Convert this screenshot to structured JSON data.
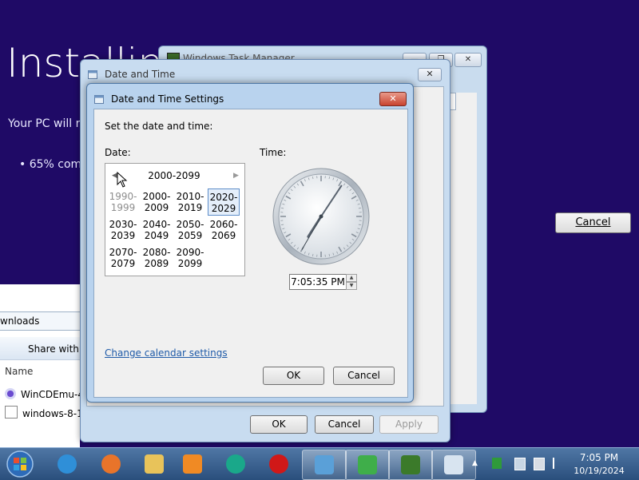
{
  "installer": {
    "title": "Installing",
    "subtitle": "Your PC will re",
    "progress_text": "65% com",
    "cancel_label": "Cancel"
  },
  "task_manager": {
    "title": "Windows Task Manager",
    "tab_fragment": "s"
  },
  "explorer": {
    "address": "wnloads",
    "share_label": "Share with",
    "column_name": "Name",
    "rows": [
      {
        "name": "WinCDEmu-4"
      },
      {
        "name": "windows-8-1-"
      }
    ]
  },
  "date_time_dialog": {
    "title": "Date and Time",
    "close_label": "✕",
    "ok_label": "OK",
    "cancel_label": "Cancel",
    "apply_label": "Apply"
  },
  "settings_dialog": {
    "title": "Date and Time Settings",
    "close_label": "✕",
    "instruction": "Set the date and time:",
    "date_label": "Date:",
    "time_label": "Time:",
    "calendar": {
      "header": "2000-2099",
      "decades": [
        {
          "top": "1990-",
          "bottom": "1999",
          "state": "dim"
        },
        {
          "top": "2000-",
          "bottom": "2009",
          "state": "normal"
        },
        {
          "top": "2010-",
          "bottom": "2019",
          "state": "normal"
        },
        {
          "top": "2020-",
          "bottom": "2029",
          "state": "selected"
        },
        {
          "top": "2030-",
          "bottom": "2039",
          "state": "normal"
        },
        {
          "top": "2040-",
          "bottom": "2049",
          "state": "normal"
        },
        {
          "top": "2050-",
          "bottom": "2059",
          "state": "normal"
        },
        {
          "top": "2060-",
          "bottom": "2069",
          "state": "normal"
        },
        {
          "top": "2070-",
          "bottom": "2079",
          "state": "normal"
        },
        {
          "top": "2080-",
          "bottom": "2089",
          "state": "normal"
        },
        {
          "top": "2090-",
          "bottom": "2099",
          "state": "normal"
        }
      ]
    },
    "time_value": "7:05:35 PM",
    "clock": {
      "hour": 7,
      "minute": 5,
      "second": 35
    },
    "change_calendar_link": "Change calendar settings",
    "ok_label": "OK",
    "cancel_label": "Cancel"
  },
  "taskbar": {
    "apps": [
      {
        "icon": "internet-explorer-icon",
        "color": "#2f8fd8",
        "active": false
      },
      {
        "icon": "firefox-icon",
        "color": "#e8742a",
        "active": false
      },
      {
        "icon": "folder-icon",
        "color": "#e8c35a",
        "active": false
      },
      {
        "icon": "media-player-icon",
        "color": "#f08a24",
        "active": false
      },
      {
        "icon": "teal-app-icon",
        "color": "#1aa88a",
        "active": false
      },
      {
        "icon": "opera-icon",
        "color": "#d01818",
        "active": false
      },
      {
        "icon": "control-panel-icon",
        "color": "#5aa0d8",
        "active": true
      },
      {
        "icon": "installer-icon",
        "color": "#3fae4a",
        "active": true
      },
      {
        "icon": "task-manager-icon",
        "color": "#3b7a2a",
        "active": true
      },
      {
        "icon": "date-time-icon",
        "color": "#d8e4f0",
        "active": true
      }
    ],
    "time": "7:05 PM",
    "date": "10/19/2024"
  }
}
